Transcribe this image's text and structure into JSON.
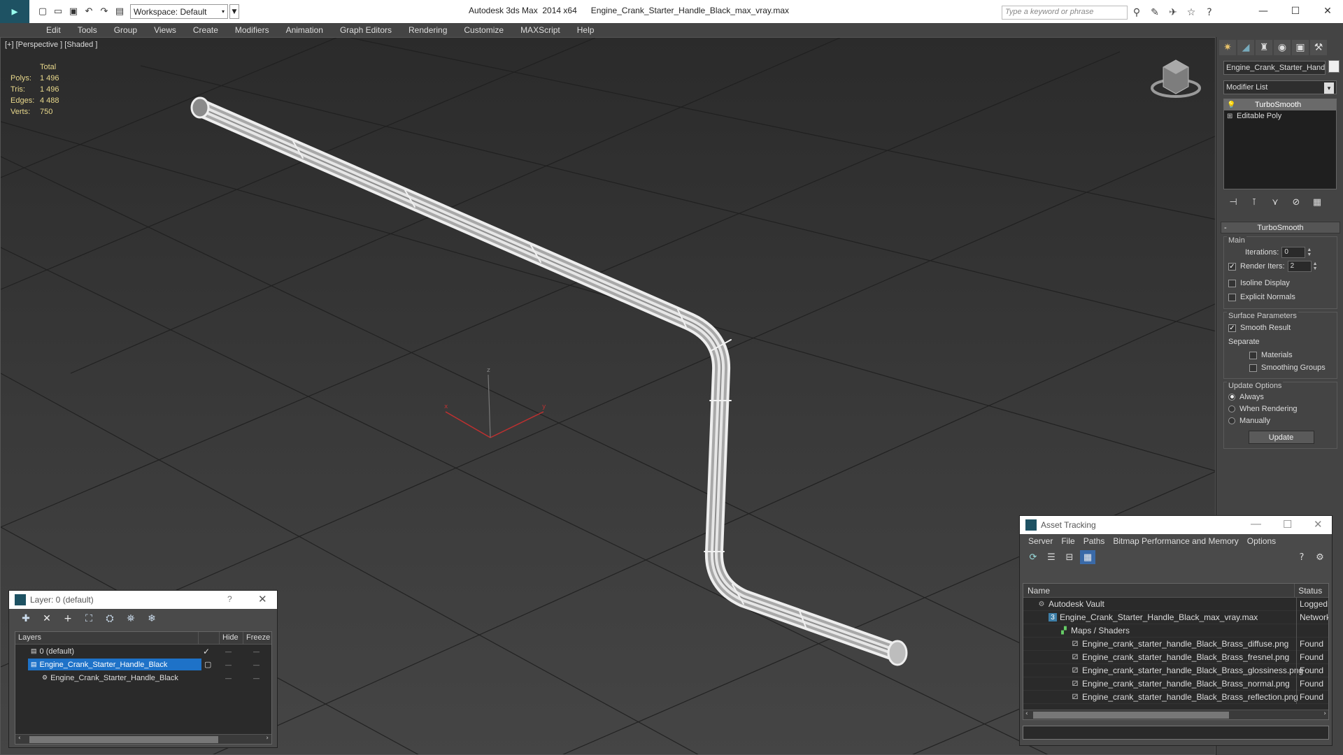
{
  "titlebar": {
    "workspace": "Workspace: Default",
    "app_title": "Autodesk 3ds Max  2014 x64      Engine_Crank_Starter_Handle_Black_max_vray.max",
    "search_placeholder": "Type a keyword or phrase"
  },
  "menu": [
    "Edit",
    "Tools",
    "Group",
    "Views",
    "Create",
    "Modifiers",
    "Animation",
    "Graph Editors",
    "Rendering",
    "Customize",
    "MAXScript",
    "Help"
  ],
  "viewport": {
    "label": "[+] [Perspective ] [Shaded ]",
    "stats": {
      "header": "Total",
      "rows": [
        {
          "k": "Polys:",
          "v": "1 496"
        },
        {
          "k": "Tris:",
          "v": "1 496"
        },
        {
          "k": "Edges:",
          "v": "4 488"
        },
        {
          "k": "Verts:",
          "v": "750"
        }
      ]
    },
    "axis_labels": {
      "x": "x",
      "y": "y",
      "z": "z"
    }
  },
  "command_panel": {
    "object_name": "Engine_Crank_Starter_Handle_Black",
    "modifier_list": "Modifier List",
    "stack": [
      "TurboSmooth",
      "Editable Poly"
    ],
    "rollout_title": "TurboSmooth",
    "main": {
      "title": "Main",
      "iterations_label": "Iterations:",
      "iterations_value": "0",
      "render_iters_label": "Render Iters:",
      "render_iters_value": "2",
      "isoline": "Isoline Display",
      "explicit": "Explicit Normals"
    },
    "surface": {
      "title": "Surface Parameters",
      "smooth": "Smooth Result",
      "separate": "Separate",
      "materials": "Materials",
      "smoothing": "Smoothing Groups"
    },
    "update": {
      "title": "Update Options",
      "always": "Always",
      "when_rendering": "When Rendering",
      "manually": "Manually",
      "button": "Update"
    }
  },
  "layer_window": {
    "title": "Layer: 0 (default)",
    "help": "?",
    "columns": [
      "Layers",
      "Hide",
      "Freeze"
    ],
    "rows": [
      "0 (default)",
      "Engine_Crank_Starter_Handle_Black",
      "Engine_Crank_Starter_Handle_Black"
    ]
  },
  "asset_window": {
    "title": "Asset Tracking",
    "menu": [
      "Server",
      "File",
      "Paths",
      "Bitmap Performance and Memory",
      "Options"
    ],
    "columns": [
      "Name",
      "Status"
    ],
    "rows": [
      {
        "name": "Autodesk Vault",
        "status": "Logged O"
      },
      {
        "name": "Engine_Crank_Starter_Handle_Black_max_vray.max",
        "status": "Network"
      },
      {
        "name": "Maps / Shaders",
        "status": ""
      },
      {
        "name": "Engine_crank_starter_handle_Black_Brass_diffuse.png",
        "status": "Found"
      },
      {
        "name": "Engine_crank_starter_handle_Black_Brass_fresnel.png",
        "status": "Found"
      },
      {
        "name": "Engine_crank_starter_handle_Black_Brass_glossiness.png",
        "status": "Found"
      },
      {
        "name": "Engine_crank_starter_handle_Black_Brass_normal.png",
        "status": "Found"
      },
      {
        "name": "Engine_crank_starter_handle_Black_Brass_reflection.png",
        "status": "Found"
      }
    ]
  }
}
